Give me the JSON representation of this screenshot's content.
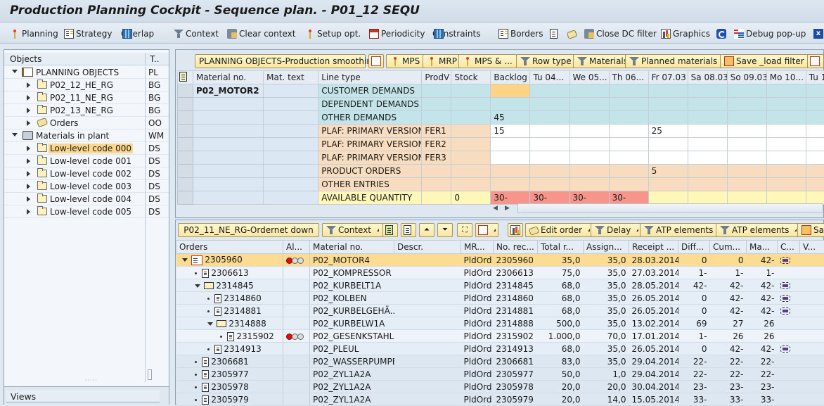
{
  "window": {
    "title": "Production Planning Cockpit - Sequence plan. - P01_12 SEQU"
  },
  "toolbar": {
    "items": [
      {
        "label": "Planning",
        "icon": "pin-icon"
      },
      {
        "label": "Strategy",
        "icon": "strategy-icon"
      },
      {
        "label": "Overlap",
        "icon": "grid-icon"
      },
      {
        "label": "Context",
        "icon": "filter-icon"
      },
      {
        "label": "Clear context",
        "icon": "clear-filter-icon"
      },
      {
        "label": "Setup opt.",
        "icon": "pin-icon"
      },
      {
        "label": "Periodicity",
        "icon": "calendar-icon"
      },
      {
        "label": "Constraints",
        "icon": "grid-icon"
      },
      {
        "label": "Borders",
        "icon": "borders-icon"
      },
      {
        "label": "",
        "icon": "list-icon"
      },
      {
        "label": "",
        "icon": "scroll-icon"
      },
      {
        "label": "Close DC filter",
        "icon": "clear-filter-icon"
      },
      {
        "label": "Graphics",
        "icon": "chart-icon"
      },
      {
        "label": "",
        "icon": "refresh-icon"
      },
      {
        "label": "Debug pop-up",
        "icon": "debug-icon"
      },
      {
        "label": "",
        "icon": "close-icon"
      }
    ]
  },
  "objects_panel": {
    "headers": {
      "objects": "Objects",
      "type": "T.."
    },
    "rows": [
      {
        "label": "PLANNING OBJECTS",
        "type": "PL"
      },
      {
        "label": "P02_12_HE_RG",
        "type": "BG"
      },
      {
        "label": "P02_11_NE_RG",
        "type": "BG"
      },
      {
        "label": "P02_13_NE_RG",
        "type": "BG"
      },
      {
        "label": "Orders",
        "type": "OO"
      },
      {
        "label": "Materials in plant",
        "type": "WM"
      },
      {
        "label": "Low-level code 000",
        "type": "DS"
      },
      {
        "label": "Low-level code 001",
        "type": "DS"
      },
      {
        "label": "Low-level code 002",
        "type": "DS"
      },
      {
        "label": "Low-level code 003",
        "type": "DS"
      },
      {
        "label": "Low-level code 004",
        "type": "DS"
      },
      {
        "label": "Low-level code 005",
        "type": "DS"
      }
    ],
    "views_label": "Views"
  },
  "planning_table": {
    "toolbar": {
      "title": "PLANNING OBJECTS-Production smoothing",
      "mps": "MPS",
      "mrp": "MRP",
      "mps_and": "MPS & ...",
      "row_type": "Row type",
      "materials": "Materials",
      "planned_materials": "Planned materials",
      "save_load_filter": "Save _load filter"
    },
    "columns": [
      "Material no.",
      "Mat. text",
      "Line type",
      "ProdV",
      "Stock",
      "Backlog",
      "Tu 04...",
      "We 05...",
      "Th 06...",
      "Fr 07.03",
      "Sa 08.03",
      "So 09.03",
      "Mo 10...",
      "Tu 1"
    ],
    "material": "P02_MOTOR2",
    "rows": [
      {
        "line_type": "CUSTOMER DEMANDS",
        "prodv": "",
        "stock": "",
        "values": [
          "",
          "",
          "",
          "",
          "",
          "",
          "",
          "",
          ""
        ]
      },
      {
        "line_type": "DEPENDENT DEMANDS",
        "prodv": "",
        "stock": "",
        "values": [
          "",
          "",
          "",
          "",
          "",
          "",
          "",
          "",
          ""
        ]
      },
      {
        "line_type": "OTHER DEMANDS",
        "prodv": "",
        "stock": "",
        "values": [
          "45",
          "",
          "",
          "",
          "",
          "",
          "",
          "",
          ""
        ]
      },
      {
        "line_type": "PLAF: PRIMARY VERSION",
        "prodv": "FER1",
        "stock": "",
        "values": [
          "15",
          "",
          "",
          "",
          "25",
          "",
          "",
          "",
          ""
        ]
      },
      {
        "line_type": "PLAF: PRIMARY VERSION",
        "prodv": "FER2",
        "stock": "",
        "values": [
          "",
          "",
          "",
          "",
          "",
          "",
          "",
          "",
          ""
        ]
      },
      {
        "line_type": "PLAF: PRIMARY VERSION",
        "prodv": "FER3",
        "stock": "",
        "values": [
          "",
          "",
          "",
          "",
          "",
          "",
          "",
          "",
          ""
        ]
      },
      {
        "line_type": "PRODUCT ORDERS",
        "prodv": "",
        "stock": "",
        "values": [
          "",
          "",
          "",
          "",
          "5",
          "",
          "",
          "",
          ""
        ]
      },
      {
        "line_type": "OTHER ENTRIES",
        "prodv": "",
        "stock": "",
        "values": [
          "",
          "",
          "",
          "",
          "",
          "",
          "",
          "",
          ""
        ]
      },
      {
        "line_type": "AVAILABLE QUANTITY",
        "prodv": "",
        "stock": "0",
        "values": [
          "30-",
          "30-",
          "30-",
          "30-",
          "",
          "",
          "",
          "",
          ""
        ]
      }
    ],
    "colors": {
      "demand": "#c3e5ea",
      "supply": "#f8dcc0",
      "shortage": "#f8958a",
      "available": "#fdf7b8",
      "highlight": "#fcd484"
    }
  },
  "order_table": {
    "toolbar": {
      "title": "P02_11_NE_RG-Ordernet down",
      "context": "Context",
      "edit_order": "Edit order",
      "delay": "Delay",
      "atp1": "ATP elements",
      "atp2": "ATP elements",
      "save": "Sav"
    },
    "columns": [
      "Orders",
      "Al...",
      "Material no.",
      "Descr.",
      "MR...",
      "No. rec...",
      "Total r...",
      "Assign...",
      "Receipt ...",
      "Diff...",
      "Cum...",
      "Ma...",
      "C...",
      "V..."
    ],
    "rows": [
      {
        "order": "2305960",
        "alert": true,
        "material": "P02_MOTOR4",
        "descr": "",
        "mr": "PldOrd",
        "no_rec": "2305960",
        "total": "35,0",
        "assign": "35,0",
        "receipt": "28.03.2014",
        "diff": "0",
        "cum": "0",
        "ma": "42-",
        "c": true,
        "level": 0,
        "kind": "edit",
        "expanded": true
      },
      {
        "order": "2306613",
        "alert": false,
        "material": "P02_KOMPRESSOR",
        "descr": "",
        "mr": "PldOrd",
        "no_rec": "2306613",
        "total": "75,0",
        "assign": "35,0",
        "receipt": "27.03.2014",
        "diff": "1-",
        "cum": "1-",
        "ma": "1-",
        "c": false,
        "level": 1,
        "kind": "doc"
      },
      {
        "order": "2314845",
        "alert": false,
        "material": "P02_KURBELT1A",
        "descr": "",
        "mr": "PldOrd",
        "no_rec": "2314845",
        "total": "68,0",
        "assign": "35,0",
        "receipt": "28.05.2014",
        "diff": "42-",
        "cum": "42-",
        "ma": "42-",
        "c": true,
        "level": 1,
        "kind": "folder",
        "expanded": true
      },
      {
        "order": "2314860",
        "alert": false,
        "material": "P02_KOLBEN",
        "descr": "",
        "mr": "PldOrd",
        "no_rec": "2314860",
        "total": "68,0",
        "assign": "35,0",
        "receipt": "26.05.2014",
        "diff": "0",
        "cum": "42-",
        "ma": "42-",
        "c": true,
        "level": 2,
        "kind": "doc"
      },
      {
        "order": "2314881",
        "alert": false,
        "material": "P02_KURBELGEHÄ...",
        "descr": "",
        "mr": "PldOrd",
        "no_rec": "2314881",
        "total": "68,0",
        "assign": "35,0",
        "receipt": "26.05.2014",
        "diff": "0",
        "cum": "42-",
        "ma": "42-",
        "c": true,
        "level": 2,
        "kind": "doc"
      },
      {
        "order": "2314888",
        "alert": false,
        "material": "P02_KURBELW1A",
        "descr": "",
        "mr": "PldOrd",
        "no_rec": "2314888",
        "total": "500,0",
        "assign": "35,0",
        "receipt": "13.02.2014",
        "diff": "69",
        "cum": "27",
        "ma": "26",
        "c": false,
        "level": 2,
        "kind": "folder",
        "expanded": true
      },
      {
        "order": "2315902",
        "alert": true,
        "material": "P02_GESENKSTAHL",
        "descr": "",
        "mr": "PldOrd",
        "no_rec": "2315902",
        "total": "1.000,0",
        "assign": "70,0",
        "receipt": "17.01.2014",
        "diff": "1-",
        "cum": "26",
        "ma": "26",
        "c": false,
        "level": 3,
        "kind": "doc"
      },
      {
        "order": "2314913",
        "alert": false,
        "material": "P02_PLEUL",
        "descr": "",
        "mr": "PldOrd",
        "no_rec": "2314913",
        "total": "68,0",
        "assign": "35,0",
        "receipt": "26.05.2014",
        "diff": "0",
        "cum": "42-",
        "ma": "42-",
        "c": true,
        "level": 2,
        "kind": "doc"
      },
      {
        "order": "2306681",
        "alert": false,
        "material": "P02_WASSERPUMPE",
        "descr": "",
        "mr": "PldOrd",
        "no_rec": "2306681",
        "total": "83,0",
        "assign": "35,0",
        "receipt": "29.04.2014",
        "diff": "22-",
        "cum": "22-",
        "ma": "22-",
        "c": false,
        "level": 1,
        "kind": "doc"
      },
      {
        "order": "2305977",
        "alert": false,
        "material": "P02_ZYL1A2A",
        "descr": "",
        "mr": "PldOrd",
        "no_rec": "2305977",
        "total": "50,0",
        "assign": "1,0",
        "receipt": "29.04.2014",
        "diff": "22-",
        "cum": "22-",
        "ma": "22-",
        "c": false,
        "level": 1,
        "kind": "doc"
      },
      {
        "order": "2305978",
        "alert": false,
        "material": "P02_ZYL1A2A",
        "descr": "",
        "mr": "PldOrd",
        "no_rec": "2305978",
        "total": "20,0",
        "assign": "20,0",
        "receipt": "30.04.2014",
        "diff": "23-",
        "cum": "23-",
        "ma": "23-",
        "c": false,
        "level": 1,
        "kind": "doc"
      },
      {
        "order": "2305979",
        "alert": false,
        "material": "P02_ZYL1A2A",
        "descr": "",
        "mr": "PldOrd",
        "no_rec": "2305979",
        "total": "20,0",
        "assign": "14,0",
        "receipt": "15.05.2014",
        "diff": "33-",
        "cum": "33-",
        "ma": "33-",
        "c": false,
        "level": 1,
        "kind": "doc"
      }
    ]
  }
}
